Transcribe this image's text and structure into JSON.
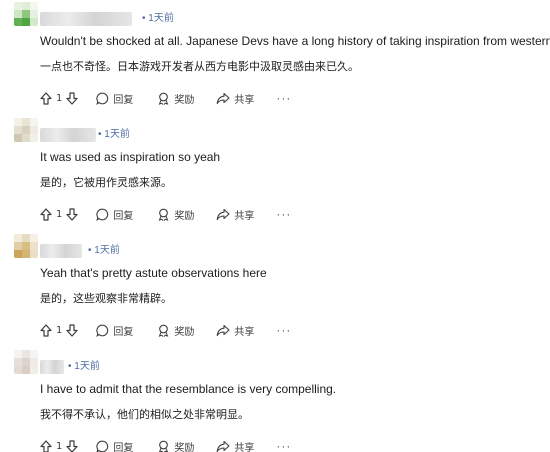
{
  "comments": [
    {
      "time": "• 1天前",
      "text_en": "Wouldn't be shocked at all. Japanese Devs have a long history of taking inspiration from western movies.",
      "text_zh": "一点也不奇怪。日本游戏开发者从西方电影中汲取灵感由来已久。",
      "votes": "1",
      "reply_label": "回复",
      "award_label": "奖励",
      "share_label": "共享",
      "more_label": "···"
    },
    {
      "time": "• 1天前",
      "text_en": "It was used as inspiration so yeah",
      "text_zh": "是的，它被用作灵感来源。",
      "votes": "1",
      "reply_label": "回复",
      "award_label": "奖励",
      "share_label": "共享",
      "more_label": "···"
    },
    {
      "time": "• 1天前",
      "text_en": "Yeah that's pretty astute observations here",
      "text_zh": "是的，这些观察非常精辟。",
      "votes": "1",
      "reply_label": "回复",
      "award_label": "奖励",
      "share_label": "共享",
      "more_label": "···"
    },
    {
      "time": "• 1天前",
      "text_en": "I have to admit that the resemblance is very compelling.",
      "text_zh": "我不得不承认，他们的相似之处非常明显。",
      "votes": "1",
      "reply_label": "回复",
      "award_label": "奖励",
      "share_label": "共享",
      "more_label": "···"
    }
  ],
  "icons": {
    "upvote": "arrow-up-icon",
    "downvote": "arrow-down-icon",
    "reply": "speech-bubble-icon",
    "award": "award-icon",
    "share": "share-arrow-icon"
  },
  "colors": {
    "meta_text": "#4f6ea3",
    "body_text": "#1c1c1c",
    "action_text": "#3c3c3c"
  }
}
